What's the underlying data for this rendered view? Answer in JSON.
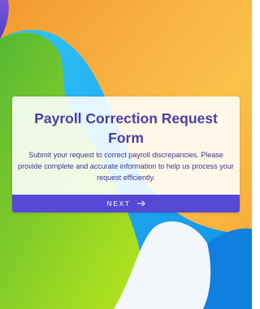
{
  "form": {
    "title": "Payroll Correction Request Form",
    "description": "Submit your request to correct payroll discrepancies. Please provide complete and accurate information to help us process your request efficiently.",
    "next_label": "NEXT",
    "next_icon": "arrow-right-icon"
  },
  "colors": {
    "title": "#4a3fa3",
    "button": "#5549d6",
    "background_orange": "#f9a53a",
    "background_blue": "#1aa8ef",
    "background_green": "#8fd12c",
    "background_purple": "#6a4fd3"
  }
}
